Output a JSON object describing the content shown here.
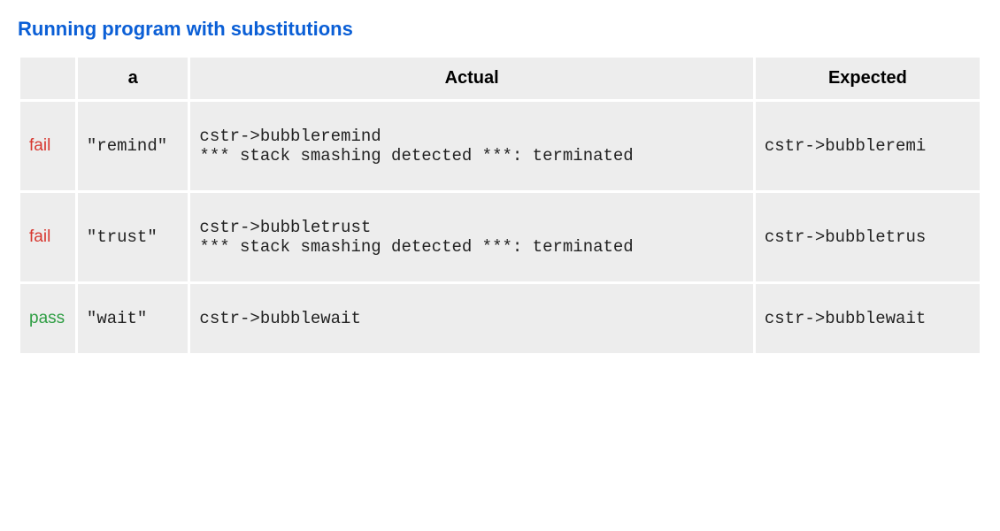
{
  "title": "Running program with substitutions",
  "headers": {
    "status": "",
    "a": "a",
    "actual": "Actual",
    "expected": "Expected"
  },
  "rows": [
    {
      "status": "fail",
      "status_class": "fail",
      "a": "\"remind\"",
      "actual": "cstr->bubbleremind\n*** stack smashing detected ***: terminated",
      "expected": "cstr->bubbleremi"
    },
    {
      "status": "fail",
      "status_class": "fail",
      "a": "\"trust\"",
      "actual": "cstr->bubbletrust\n*** stack smashing detected ***: terminated",
      "expected": "cstr->bubbletrus"
    },
    {
      "status": "pass",
      "status_class": "pass",
      "a": "\"wait\"",
      "actual": "cstr->bubblewait",
      "expected": "cstr->bubblewait"
    }
  ]
}
